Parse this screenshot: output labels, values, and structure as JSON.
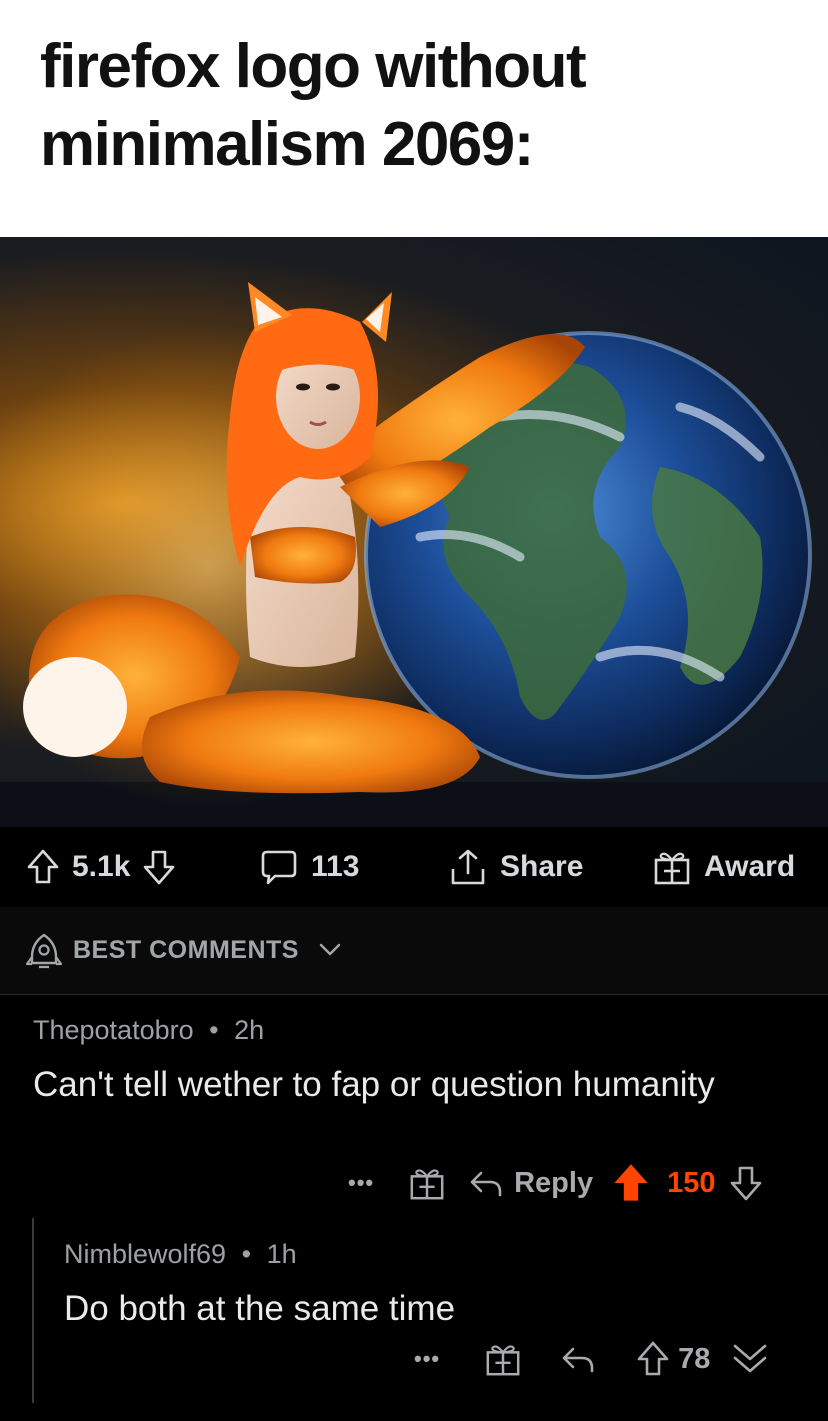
{
  "meme": {
    "caption": "firefox logo without minimalism 2069:"
  },
  "post_actions": {
    "upvotes": "5.1k",
    "comments": "113",
    "share_label": "Share",
    "award_label": "Award"
  },
  "sort": {
    "label": "BEST COMMENTS"
  },
  "comments": [
    {
      "author": "Thepotatobro",
      "age": "2h",
      "body": "Can't tell wether to fap or question humanity",
      "more": "•••",
      "reply_label": "Reply",
      "score": "150"
    },
    {
      "author": "Nimblewolf69",
      "age": "1h",
      "body": "Do both at the same time",
      "more": "•••",
      "score": "78"
    }
  ],
  "colors": {
    "upvote_active": "#ff4500",
    "text_muted": "#a8abad",
    "background": "#000000"
  }
}
